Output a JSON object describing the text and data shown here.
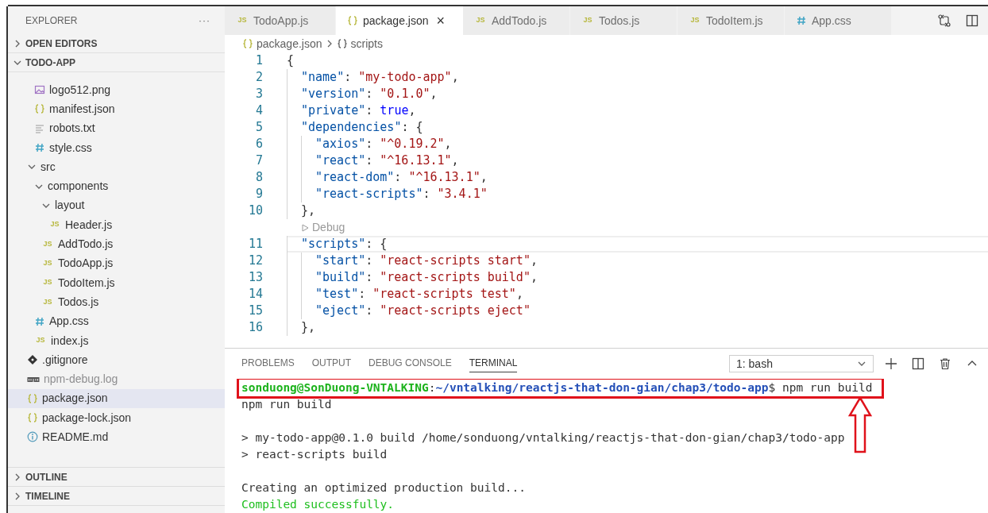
{
  "sidebar": {
    "title": "EXPLORER",
    "more": "···",
    "sections_top": [
      {
        "label": "OPEN EDITORS",
        "expanded": false
      },
      {
        "label": "TODO-APP",
        "expanded": true
      }
    ],
    "scrolled_folder_children": [
      {
        "label": "logo512.png",
        "kind": "image"
      },
      {
        "label": "manifest.json",
        "kind": "json"
      },
      {
        "label": "robots.txt",
        "kind": "text"
      },
      {
        "label": "style.css",
        "kind": "css"
      }
    ],
    "tree": [
      {
        "label": "src",
        "kind": "folder",
        "expanded": true,
        "children": [
          {
            "label": "components",
            "kind": "folder",
            "expanded": true,
            "children": [
              {
                "label": "layout",
                "kind": "folder",
                "expanded": true,
                "children": [
                  {
                    "label": "Header.js",
                    "kind": "js",
                    "icon": "JS"
                  }
                ]
              },
              {
                "label": "AddTodo.js",
                "kind": "js",
                "icon": "JS"
              },
              {
                "label": "TodoApp.js",
                "kind": "js",
                "icon": "JS"
              },
              {
                "label": "TodoItem.js",
                "kind": "js",
                "icon": "JS"
              },
              {
                "label": "Todos.js",
                "kind": "js",
                "icon": "JS"
              }
            ]
          },
          {
            "label": "App.css",
            "kind": "css"
          },
          {
            "label": "index.js",
            "kind": "js",
            "icon": "JS"
          }
        ]
      },
      {
        "label": ".gitignore",
        "kind": "git"
      },
      {
        "label": "npm-debug.log",
        "kind": "npm",
        "ignored": true
      },
      {
        "label": "package.json",
        "kind": "json",
        "selected": true
      },
      {
        "label": "package-lock.json",
        "kind": "json"
      },
      {
        "label": "README.md",
        "kind": "info"
      }
    ],
    "sections_bottom": [
      {
        "label": "OUTLINE",
        "expanded": false
      },
      {
        "label": "TIMELINE",
        "expanded": false
      }
    ]
  },
  "tabs": [
    {
      "label": "TodoApp.js",
      "kind": "js",
      "icon": "JS",
      "selected": false
    },
    {
      "label": "package.json",
      "kind": "json",
      "selected": true,
      "close": "×"
    },
    {
      "label": "AddTodo.js",
      "kind": "js",
      "icon": "JS",
      "selected": false
    },
    {
      "label": "Todos.js",
      "kind": "js",
      "icon": "JS",
      "selected": false
    },
    {
      "label": "TodoItem.js",
      "kind": "js",
      "icon": "JS",
      "selected": false
    },
    {
      "label": "App.css",
      "kind": "css",
      "selected": false
    }
  ],
  "breadcrumb": [
    {
      "label": "package.json",
      "kind": "json"
    },
    {
      "label": "scripts",
      "kind": "object"
    }
  ],
  "code": [
    {
      "number": "1",
      "tokens": [
        {
          "text": "{",
          "kind": "punct"
        }
      ],
      "children": [
        {
          "number": "2",
          "tokens": [
            {
              "text": "\"name\"",
              "kind": "key"
            },
            {
              "text": ": ",
              "kind": "punct"
            },
            {
              "text": "\"my-todo-app\"",
              "kind": "string"
            },
            {
              "text": ",",
              "kind": "punct"
            }
          ]
        },
        {
          "number": "3",
          "tokens": [
            {
              "text": "\"version\"",
              "kind": "key"
            },
            {
              "text": ": ",
              "kind": "punct"
            },
            {
              "text": "\"0.1.0\"",
              "kind": "string"
            },
            {
              "text": ",",
              "kind": "punct"
            }
          ]
        },
        {
          "number": "4",
          "tokens": [
            {
              "text": "\"private\"",
              "kind": "key"
            },
            {
              "text": ": ",
              "kind": "punct"
            },
            {
              "text": "true",
              "kind": "literal"
            },
            {
              "text": ",",
              "kind": "punct"
            }
          ]
        },
        {
          "number": "5",
          "tokens": [
            {
              "text": "\"dependencies\"",
              "kind": "key"
            },
            {
              "text": ": {",
              "kind": "punct"
            }
          ],
          "children": [
            {
              "number": "6",
              "tokens": [
                {
                  "text": "\"axios\"",
                  "kind": "key"
                },
                {
                  "text": ": ",
                  "kind": "punct"
                },
                {
                  "text": "\"^0.19.2\"",
                  "kind": "string"
                },
                {
                  "text": ",",
                  "kind": "punct"
                }
              ]
            },
            {
              "number": "7",
              "tokens": [
                {
                  "text": "\"react\"",
                  "kind": "key"
                },
                {
                  "text": ": ",
                  "kind": "punct"
                },
                {
                  "text": "\"^16.13.1\"",
                  "kind": "string"
                },
                {
                  "text": ",",
                  "kind": "punct"
                }
              ]
            },
            {
              "number": "8",
              "tokens": [
                {
                  "text": "\"react-dom\"",
                  "kind": "key"
                },
                {
                  "text": ": ",
                  "kind": "punct"
                },
                {
                  "text": "\"^16.13.1\"",
                  "kind": "string"
                },
                {
                  "text": ",",
                  "kind": "punct"
                }
              ]
            },
            {
              "number": "9",
              "tokens": [
                {
                  "text": "\"react-scripts\"",
                  "kind": "key"
                },
                {
                  "text": ": ",
                  "kind": "punct"
                },
                {
                  "text": "\"3.4.1\"",
                  "kind": "string"
                }
              ]
            }
          ]
        },
        {
          "number": "10",
          "tokens": [
            {
              "text": "},",
              "kind": "punct"
            }
          ]
        },
        {
          "codelens": "Debug"
        },
        {
          "number": "11",
          "current": true,
          "tokens": [
            {
              "text": "\"scripts\"",
              "kind": "key"
            },
            {
              "text": ": {",
              "kind": "punct"
            }
          ],
          "children": [
            {
              "number": "12",
              "tokens": [
                {
                  "text": "\"start\"",
                  "kind": "key"
                },
                {
                  "text": ": ",
                  "kind": "punct"
                },
                {
                  "text": "\"react-scripts start\"",
                  "kind": "string"
                },
                {
                  "text": ",",
                  "kind": "punct"
                }
              ]
            },
            {
              "number": "13",
              "tokens": [
                {
                  "text": "\"build\"",
                  "kind": "key"
                },
                {
                  "text": ": ",
                  "kind": "punct"
                },
                {
                  "text": "\"react-scripts build\"",
                  "kind": "string"
                },
                {
                  "text": ",",
                  "kind": "punct"
                }
              ]
            },
            {
              "number": "14",
              "tokens": [
                {
                  "text": "\"test\"",
                  "kind": "key"
                },
                {
                  "text": ": ",
                  "kind": "punct"
                },
                {
                  "text": "\"react-scripts test\"",
                  "kind": "string"
                },
                {
                  "text": ",",
                  "kind": "punct"
                }
              ]
            },
            {
              "number": "15",
              "tokens": [
                {
                  "text": "\"eject\"",
                  "kind": "key"
                },
                {
                  "text": ": ",
                  "kind": "punct"
                },
                {
                  "text": "\"react-scripts eject\"",
                  "kind": "string"
                }
              ]
            }
          ]
        },
        {
          "number": "16",
          "tokens": [
            {
              "text": "},",
              "kind": "punct"
            }
          ]
        }
      ]
    }
  ],
  "panel": {
    "tabs": [
      {
        "label": "PROBLEMS",
        "selected": false
      },
      {
        "label": "OUTPUT",
        "selected": false
      },
      {
        "label": "DEBUG CONSOLE",
        "selected": false
      },
      {
        "label": "TERMINAL",
        "selected": true
      }
    ],
    "terminal_select": "1: bash",
    "terminal": [
      {
        "kind": "text",
        "highlighted": true,
        "segments": [
          {
            "text": "sonduong@SonDuong-VNTALKING",
            "kind": "user"
          },
          {
            "text": ":",
            "kind": "plain"
          },
          {
            "text": "~/vntalking/reactjs-that-don-gian/chap3/todo-app",
            "kind": "path"
          },
          {
            "text": "$ npm run build",
            "kind": "plain"
          }
        ]
      },
      {
        "kind": "text",
        "segments": [
          {
            "text": "npm run build",
            "kind": "plain"
          }
        ]
      },
      {
        "kind": "blank"
      },
      {
        "kind": "text",
        "segments": [
          {
            "text": "> my-todo-app@0.1.0 build /home/sonduong/vntalking/reactjs-that-don-gian/chap3/todo-app",
            "kind": "plain"
          }
        ]
      },
      {
        "kind": "text",
        "segments": [
          {
            "text": "> react-scripts build",
            "kind": "plain"
          }
        ]
      },
      {
        "kind": "blank"
      },
      {
        "kind": "text",
        "segments": [
          {
            "text": "Creating an optimized production build...",
            "kind": "plain"
          }
        ]
      },
      {
        "kind": "text",
        "segments": [
          {
            "text": "Compiled successfully.",
            "kind": "success"
          }
        ]
      }
    ]
  }
}
